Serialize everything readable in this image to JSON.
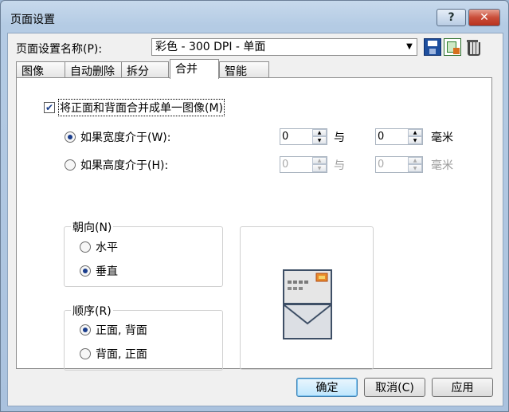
{
  "window": {
    "title": "页面设置",
    "help_label": "?",
    "close_label": "✕"
  },
  "profile": {
    "label": "页面设置名称(P):",
    "value": "彩色 - 300 DPI - 单面"
  },
  "tabs": [
    {
      "label": "图像"
    },
    {
      "label": "自动删除"
    },
    {
      "label": "拆分"
    },
    {
      "label": "合并"
    },
    {
      "label": "智能 QC"
    }
  ],
  "merge": {
    "checkbox_label": "将正面和背面合并成单一图像(M)",
    "checked": true,
    "width_option": {
      "label": "如果宽度介于(W):",
      "from": "0",
      "and": "与",
      "to": "0",
      "unit": "毫米"
    },
    "height_option": {
      "label": "如果高度介于(H):",
      "from": "0",
      "and": "与",
      "to": "0",
      "unit": "毫米"
    },
    "orientation": {
      "label": "朝向(N)",
      "options": [
        "水平",
        "垂直"
      ],
      "selected": "垂直"
    },
    "order": {
      "label": "顺序(R)",
      "options": [
        "正面, 背面",
        "背面, 正面"
      ],
      "selected": "正面, 背面"
    }
  },
  "buttons": {
    "ok": "确定",
    "cancel": "取消(C)",
    "apply": "应用"
  },
  "colors": {
    "accent": "#1a3d8c",
    "title_bar": "#b4cbe4",
    "close": "#c94d39"
  },
  "icons": [
    "save-icon",
    "save-as-icon",
    "trash-icon",
    "envelope-icon"
  ]
}
